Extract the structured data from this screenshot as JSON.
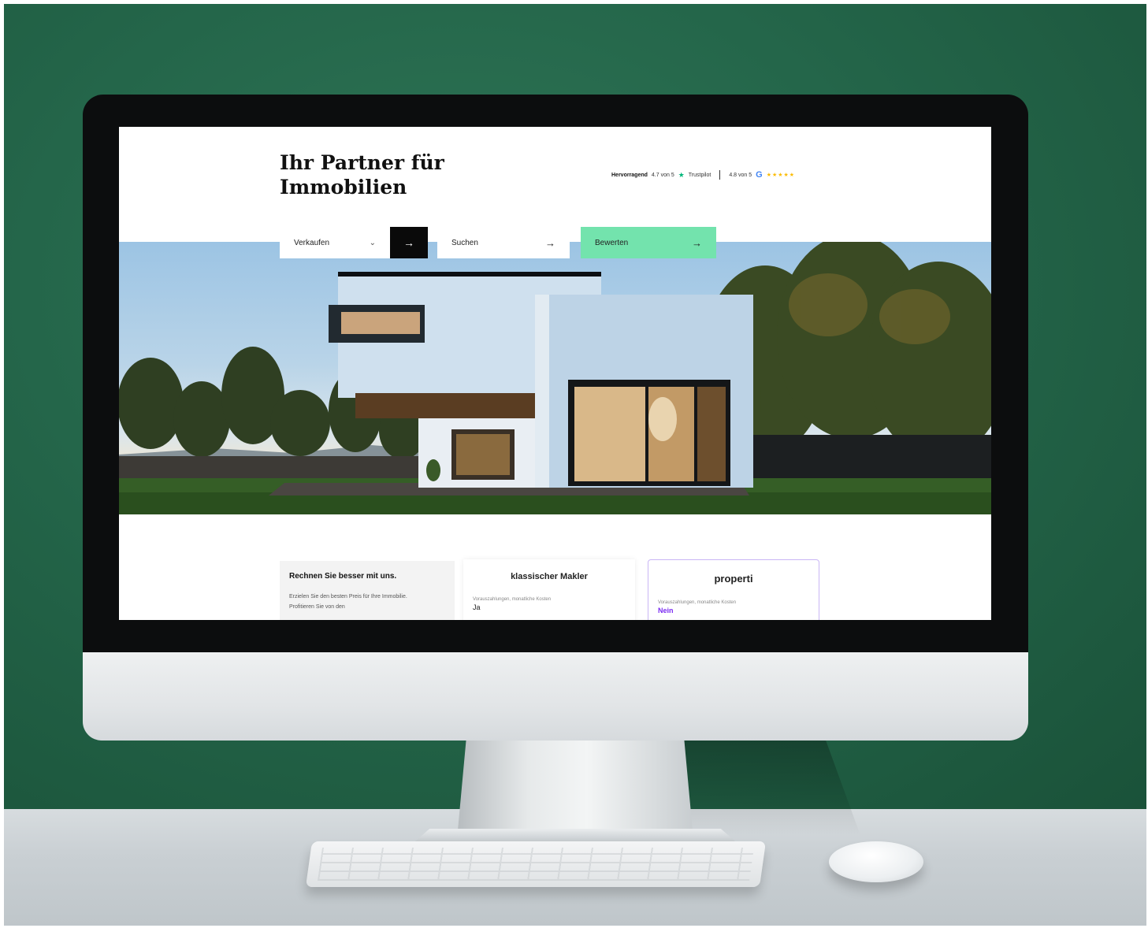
{
  "colors": {
    "wall": "#24664a",
    "accent_green": "#73e3ad",
    "accent_purple": "#7b2cf2",
    "dark_button": "#0a0a0a"
  },
  "header": {
    "title": "Ihr Partner für Immobilien"
  },
  "ratings": {
    "trustpilot_label": "Hervorragend",
    "trustpilot_score": "4.7 von 5",
    "trustpilot_icon": "trustpilot-star-icon",
    "trustpilot_brand": "Trustpilot",
    "google_score": "4.8 von 5",
    "google_icon": "google-g-icon",
    "google_stars": "★★★★★"
  },
  "actions": {
    "sell_label": "Verkaufen",
    "sell_icon": "chevron-down-icon",
    "go_icon": "arrow-right-icon",
    "buy_label": "Suchen",
    "rate_label": "Bewerten"
  },
  "comparison": {
    "intro_title": "Rechnen Sie besser mit uns.",
    "intro_text": "Erzielen Sie den besten Preis für Ihre Immobilie. Profitieren Sie von den",
    "cards": [
      {
        "title": "klassischer Makler",
        "label": "Vorauszahlungen, monatliche Kosten",
        "value": "Ja"
      },
      {
        "title": "properti",
        "label": "Vorauszahlungen, monatliche Kosten",
        "value": "Nein"
      }
    ]
  }
}
